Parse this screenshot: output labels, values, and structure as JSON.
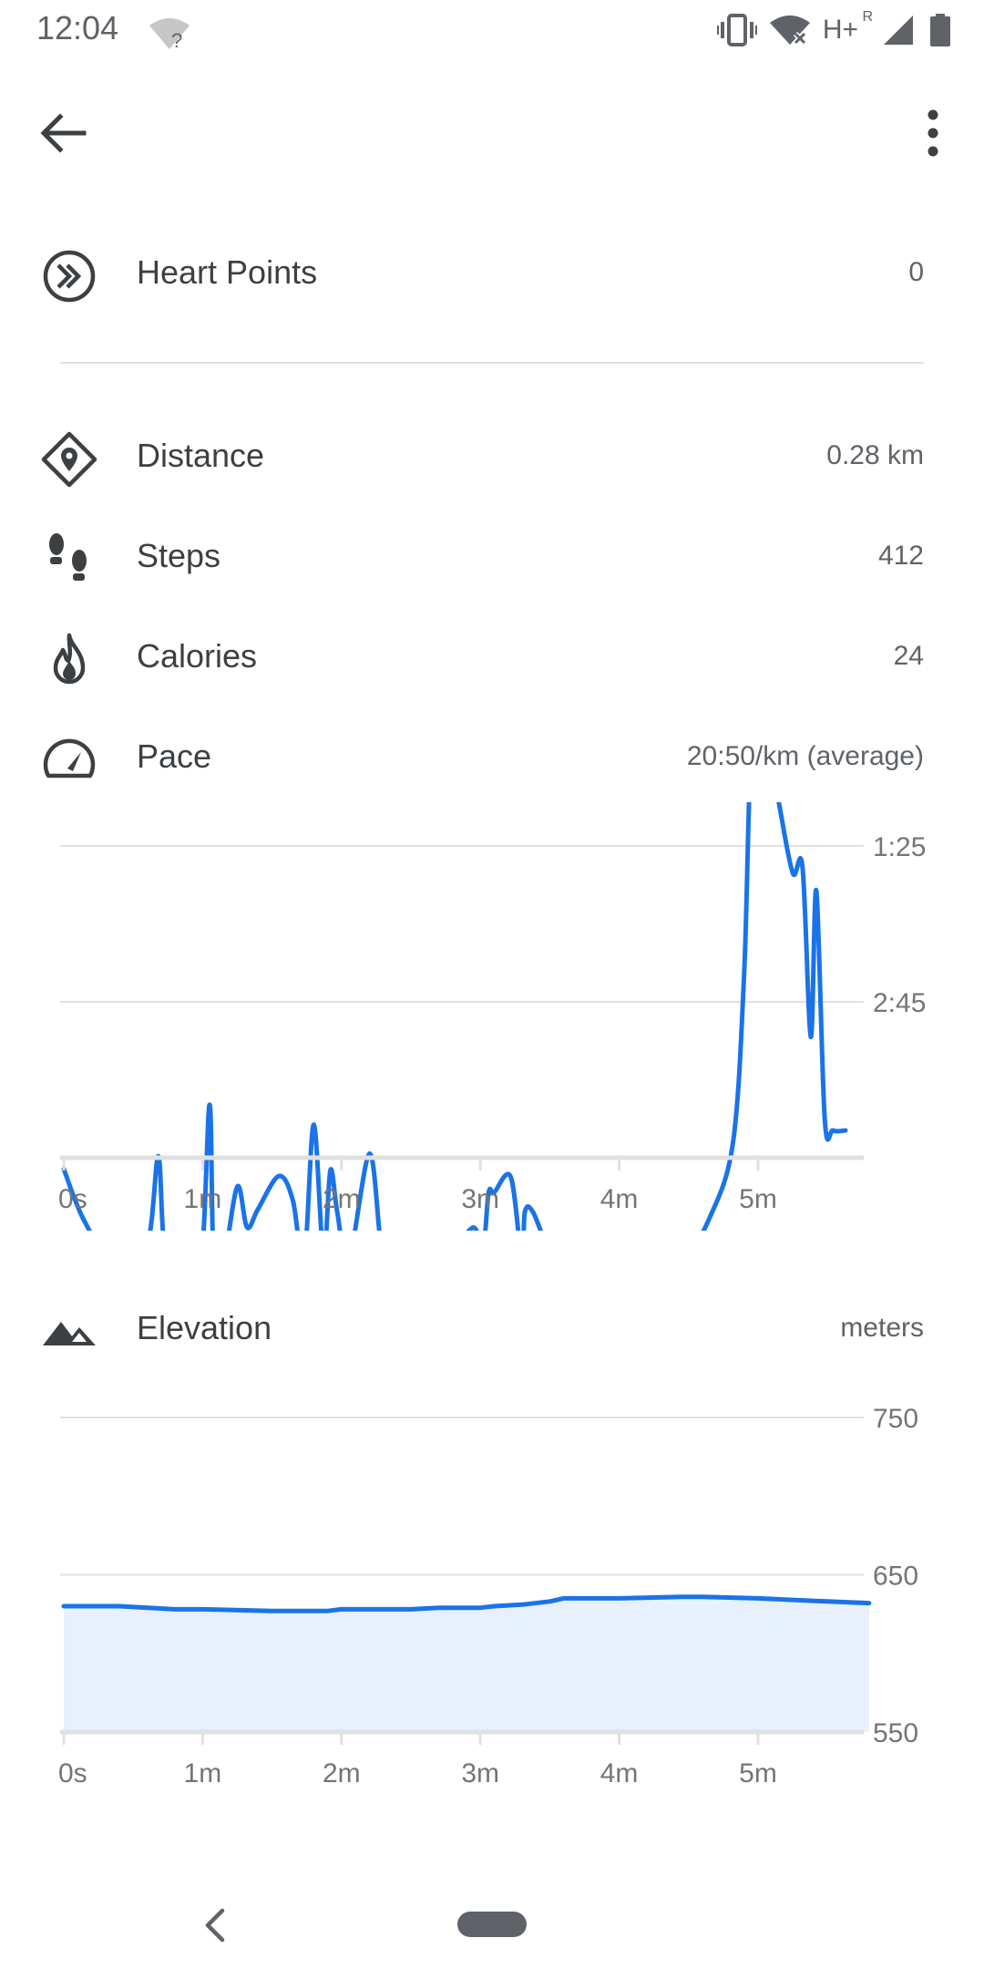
{
  "status_bar": {
    "time": "12:04",
    "network": "H+",
    "roaming": "R"
  },
  "metrics": [
    {
      "icon": "heart-points-icon",
      "label": "Heart Points",
      "value": "0"
    },
    {
      "icon": "distance-icon",
      "label": "Distance",
      "value": "0.28 km"
    },
    {
      "icon": "steps-icon",
      "label": "Steps",
      "value": "412"
    },
    {
      "icon": "calories-icon",
      "label": "Calories",
      "value": "24"
    },
    {
      "icon": "pace-icon",
      "label": "Pace",
      "value": "20:50/km (average)"
    }
  ],
  "elevation": {
    "icon": "elevation-icon",
    "label": "Elevation",
    "unit": "meters"
  },
  "colors": {
    "accent": "#1a73e8",
    "fill": "#e8f0fe",
    "grid": "#e0e0e0"
  },
  "chart_data": [
    {
      "type": "line",
      "title": "",
      "xlabel": "",
      "ylabel": "",
      "x_ticks": [
        "0s",
        "1m",
        "2m",
        "3m",
        "4m",
        "5m"
      ],
      "y_ticks": [
        "1:25",
        "2:45"
      ],
      "y_axis_inverted": true,
      "xlim_min": [
        0,
        5.8
      ],
      "ylim_min_per_km": [
        0.083,
        5.4
      ],
      "series": [
        {
          "x_min": [
            0.0,
            0.15,
            0.4,
            0.6,
            0.68,
            0.72,
            0.8,
            0.98,
            1.05,
            1.08,
            1.15,
            1.25,
            1.32,
            1.4,
            1.55,
            1.65,
            1.73,
            1.8,
            1.87,
            1.92,
            1.97,
            2.05,
            2.2,
            2.28,
            2.32,
            2.38,
            2.5,
            2.58,
            2.65,
            2.72,
            2.8,
            2.95,
            3.02,
            3.06,
            3.1,
            3.22,
            3.3,
            3.32,
            3.38,
            3.5,
            3.6,
            3.7,
            3.8,
            4.0,
            4.2,
            4.45,
            4.65,
            4.82,
            4.9,
            4.95,
            5.03,
            5.15,
            5.25,
            5.32,
            5.38,
            5.42,
            5.48,
            5.54,
            5.63
          ],
          "y_min_per_km": [
            4.18,
            4.63,
            5.07,
            4.84,
            4.07,
            4.78,
            4.98,
            5.04,
            3.63,
            4.98,
            4.98,
            4.33,
            4.68,
            4.52,
            4.24,
            4.45,
            4.98,
            3.8,
            4.92,
            4.19,
            4.55,
            4.98,
            4.05,
            4.78,
            4.75,
            4.88,
            4.82,
            4.88,
            4.98,
            4.85,
            4.88,
            4.68,
            4.85,
            4.38,
            4.38,
            4.25,
            4.98,
            4.55,
            4.55,
            4.92,
            5.2,
            5.3,
            5.3,
            5.25,
            5.15,
            4.98,
            4.6,
            3.95,
            2.5,
            0.6,
            0.3,
            1.05,
            1.65,
            1.6,
            3.05,
            1.8,
            3.75,
            3.85,
            3.85
          ]
        }
      ]
    },
    {
      "type": "area",
      "title": "",
      "xlabel": "",
      "ylabel": "meters",
      "x_ticks": [
        "0s",
        "1m",
        "2m",
        "3m",
        "4m",
        "5m"
      ],
      "y_ticks": [
        "750",
        "650",
        "550"
      ],
      "xlim_min": [
        0,
        5.8
      ],
      "ylim": [
        550,
        750
      ],
      "series": [
        {
          "x_min": [
            0.0,
            0.4,
            0.8,
            1.0,
            1.5,
            1.9,
            2.0,
            2.5,
            2.7,
            3.0,
            3.1,
            3.3,
            3.5,
            3.6,
            4.0,
            4.45,
            4.6,
            5.0,
            5.5,
            5.8
          ],
          "y_m": [
            630,
            630,
            628,
            628,
            627,
            627,
            628,
            628,
            629,
            629,
            630,
            631,
            633,
            635,
            635,
            636,
            636,
            635,
            633,
            632
          ]
        }
      ]
    }
  ]
}
